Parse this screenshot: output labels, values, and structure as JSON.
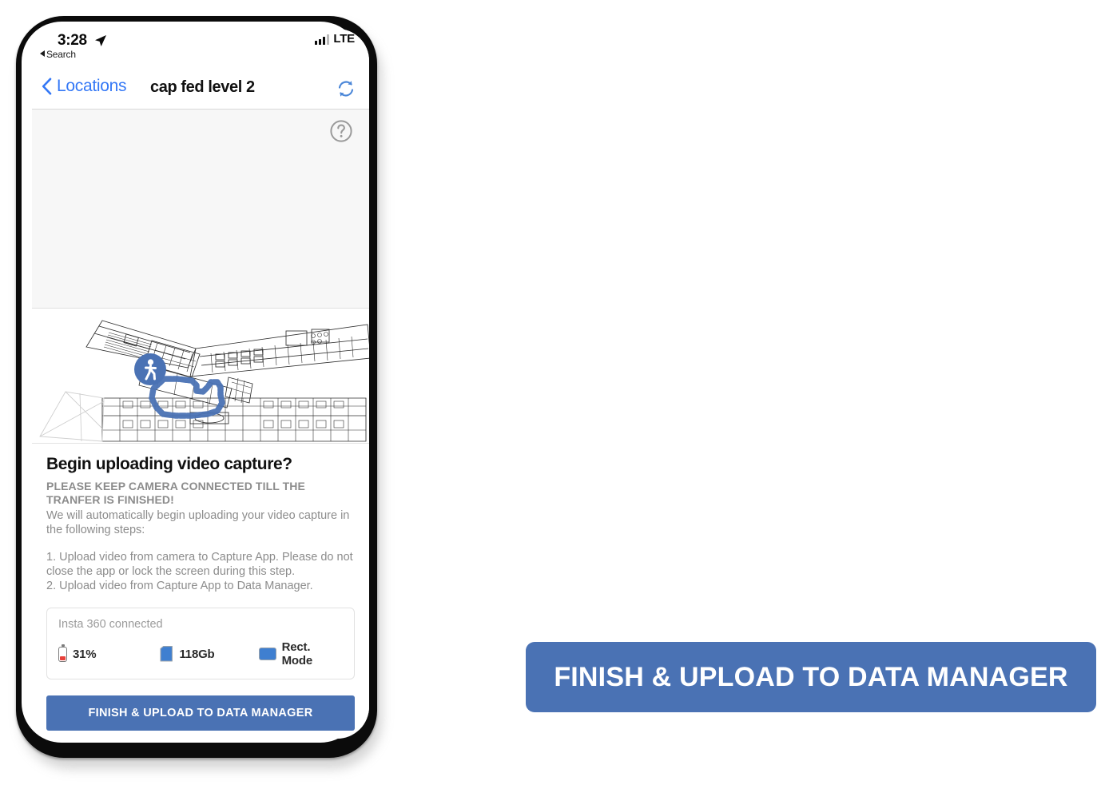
{
  "status_bar": {
    "time": "3:28",
    "location_arrow_icon": "location-arrow-icon",
    "back_to_app_label": "Search",
    "signal_icon": "signal-bars-icon",
    "carrier": "LTE"
  },
  "nav_bar": {
    "back_label": "Locations",
    "back_chevron_icon": "chevron-left-icon",
    "title": "cap fed level 2",
    "refresh_icon": "refresh-icon"
  },
  "preview_panel": {
    "help_icon": "question-circle-icon"
  },
  "floorplan": {
    "walker_marker_icon": "walking-person-icon",
    "path_color": "#4a72b4",
    "plan_line_color": "#2b2b2b"
  },
  "dialog": {
    "title": "Begin uploading video capture?",
    "warning": "PLEASE KEEP CAMERA CONNECTED TILL THE TRANFER IS FINISHED!",
    "intro": "We will automatically begin uploading your video capture in the following steps:",
    "steps": [
      "1. Upload video from camera to Capture App. Please do not close the app or lock the screen during this step.",
      "2. Upload video from Capture App to Data Manager."
    ]
  },
  "device_card": {
    "connection_label": "Insta 360 connected",
    "stats": [
      {
        "icon": "battery-icon",
        "value": "31%"
      },
      {
        "icon": "sdcard-icon",
        "value": "118Gb"
      },
      {
        "icon": "lens-rect-mode-icon",
        "value": "Rect. Mode"
      }
    ]
  },
  "primary_button": {
    "label": "FINISH & UPLOAD TO DATA MANAGER"
  },
  "callout_button": {
    "label": "FINISH & UPLOAD TO DATA MANAGER",
    "color": "#4a72b4"
  }
}
